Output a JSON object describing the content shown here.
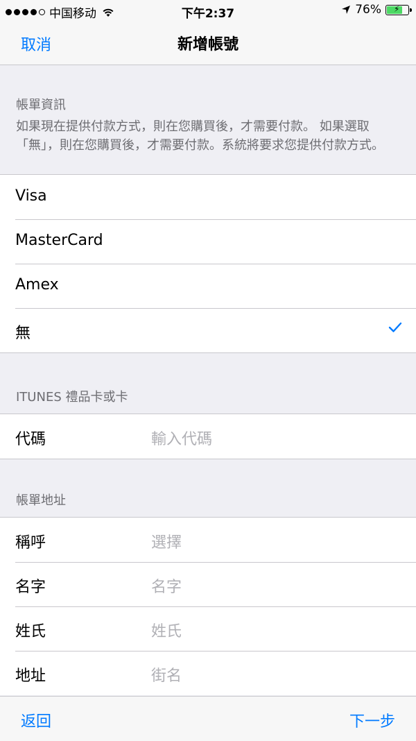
{
  "status_bar": {
    "carrier": "中国移动",
    "time": "下午2:37",
    "battery": "76%",
    "battery_level": 0.76
  },
  "nav": {
    "cancel_label": "取消",
    "title": "新增帳號"
  },
  "billing_info": {
    "header": "帳單資訊",
    "description": "如果現在提供付款方式，則在您購買後，才需要付款。 如果選取「無」，則在您購買後，才需要付款。系統將要求您提供付款方式。",
    "options": [
      {
        "label": "Visa",
        "selected": false
      },
      {
        "label": "MasterCard",
        "selected": false
      },
      {
        "label": "Amex",
        "selected": false
      },
      {
        "label": "無",
        "selected": true
      }
    ]
  },
  "itunes_card": {
    "header": "ITUNES 禮品卡或卡",
    "code_label": "代碼",
    "code_placeholder": "輸入代碼"
  },
  "billing_address": {
    "header": "帳單地址",
    "rows": [
      {
        "label": "稱呼",
        "value": "選擇"
      },
      {
        "label": "名字",
        "value": "名字"
      },
      {
        "label": "姓氏",
        "value": "姓氏"
      },
      {
        "label": "地址",
        "value": "街名"
      }
    ]
  },
  "toolbar": {
    "back_label": "返回",
    "next_label": "下一步"
  },
  "colors": {
    "accent": "#007aff",
    "battery": "#4cd964",
    "background": "#efeff4"
  }
}
